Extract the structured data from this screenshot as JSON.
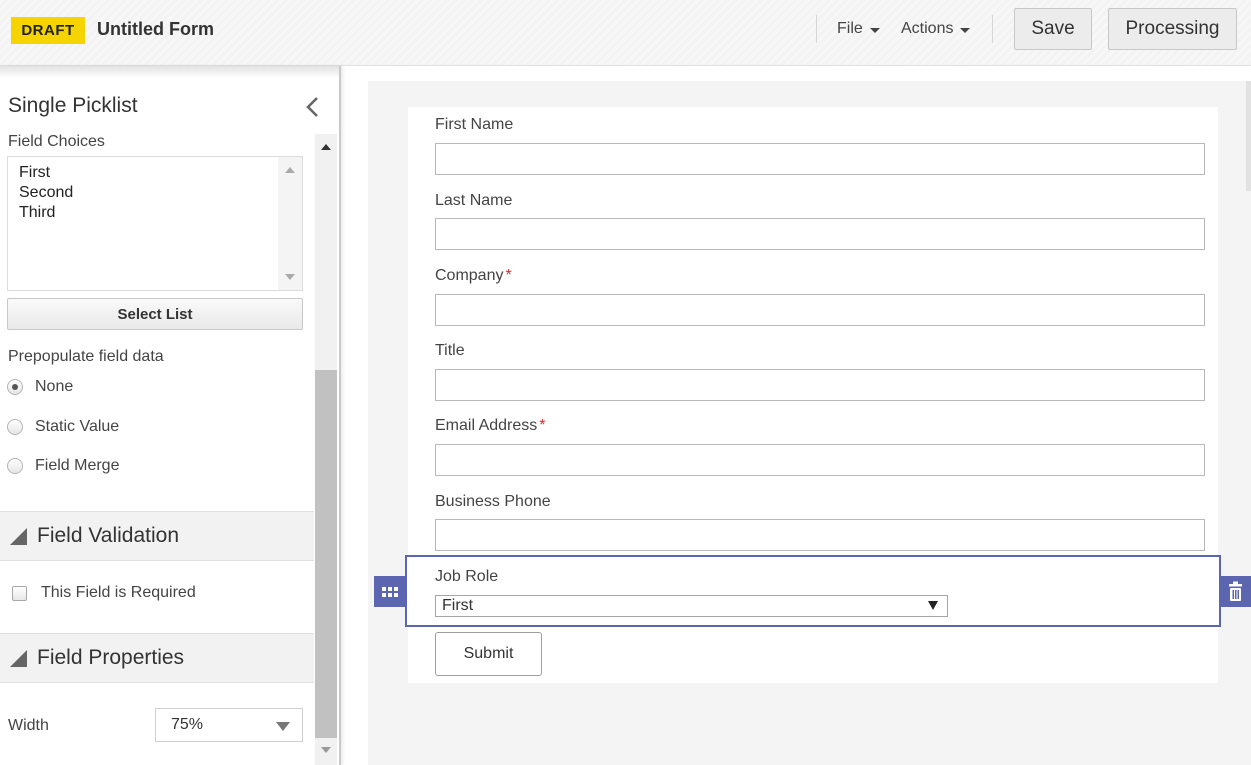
{
  "header": {
    "badge": "DRAFT",
    "title": "Untitled Form",
    "menus": [
      "File",
      "Actions"
    ],
    "save_label": "Save",
    "processing_label": "Processing"
  },
  "left_panel": {
    "title": "Single Picklist",
    "field_choices_label": "Field Choices",
    "choices": [
      "First",
      "Second",
      "Third"
    ],
    "select_list_label": "Select List",
    "prepopulate_label": "Prepopulate field data",
    "prepopulate_options": [
      "None",
      "Static Value",
      "Field Merge"
    ],
    "prepopulate_selected": "None",
    "validation_section": "Field Validation",
    "required_label": "This Field is Required",
    "properties_section": "Field Properties",
    "width_label": "Width",
    "width_value": "75%"
  },
  "form": {
    "fields": [
      {
        "label": "First Name",
        "required": false
      },
      {
        "label": "Last Name",
        "required": false
      },
      {
        "label": "Company",
        "required": true
      },
      {
        "label": "Title",
        "required": false
      },
      {
        "label": "Email Address",
        "required": true
      },
      {
        "label": "Business Phone",
        "required": false
      }
    ],
    "required_marker": "*",
    "job_role_label": "Job Role",
    "job_role_value": "First",
    "submit_label": "Submit"
  },
  "colors": {
    "draft_badge": "#f5d400",
    "selection_accent": "#5b65b0",
    "required_marker": "#d32f2f"
  },
  "icons": [
    "collapse-chevron-icon",
    "dropdown-caret-icon",
    "drag-grid-icon",
    "trash-icon",
    "section-collapse-triangle-icon"
  ]
}
